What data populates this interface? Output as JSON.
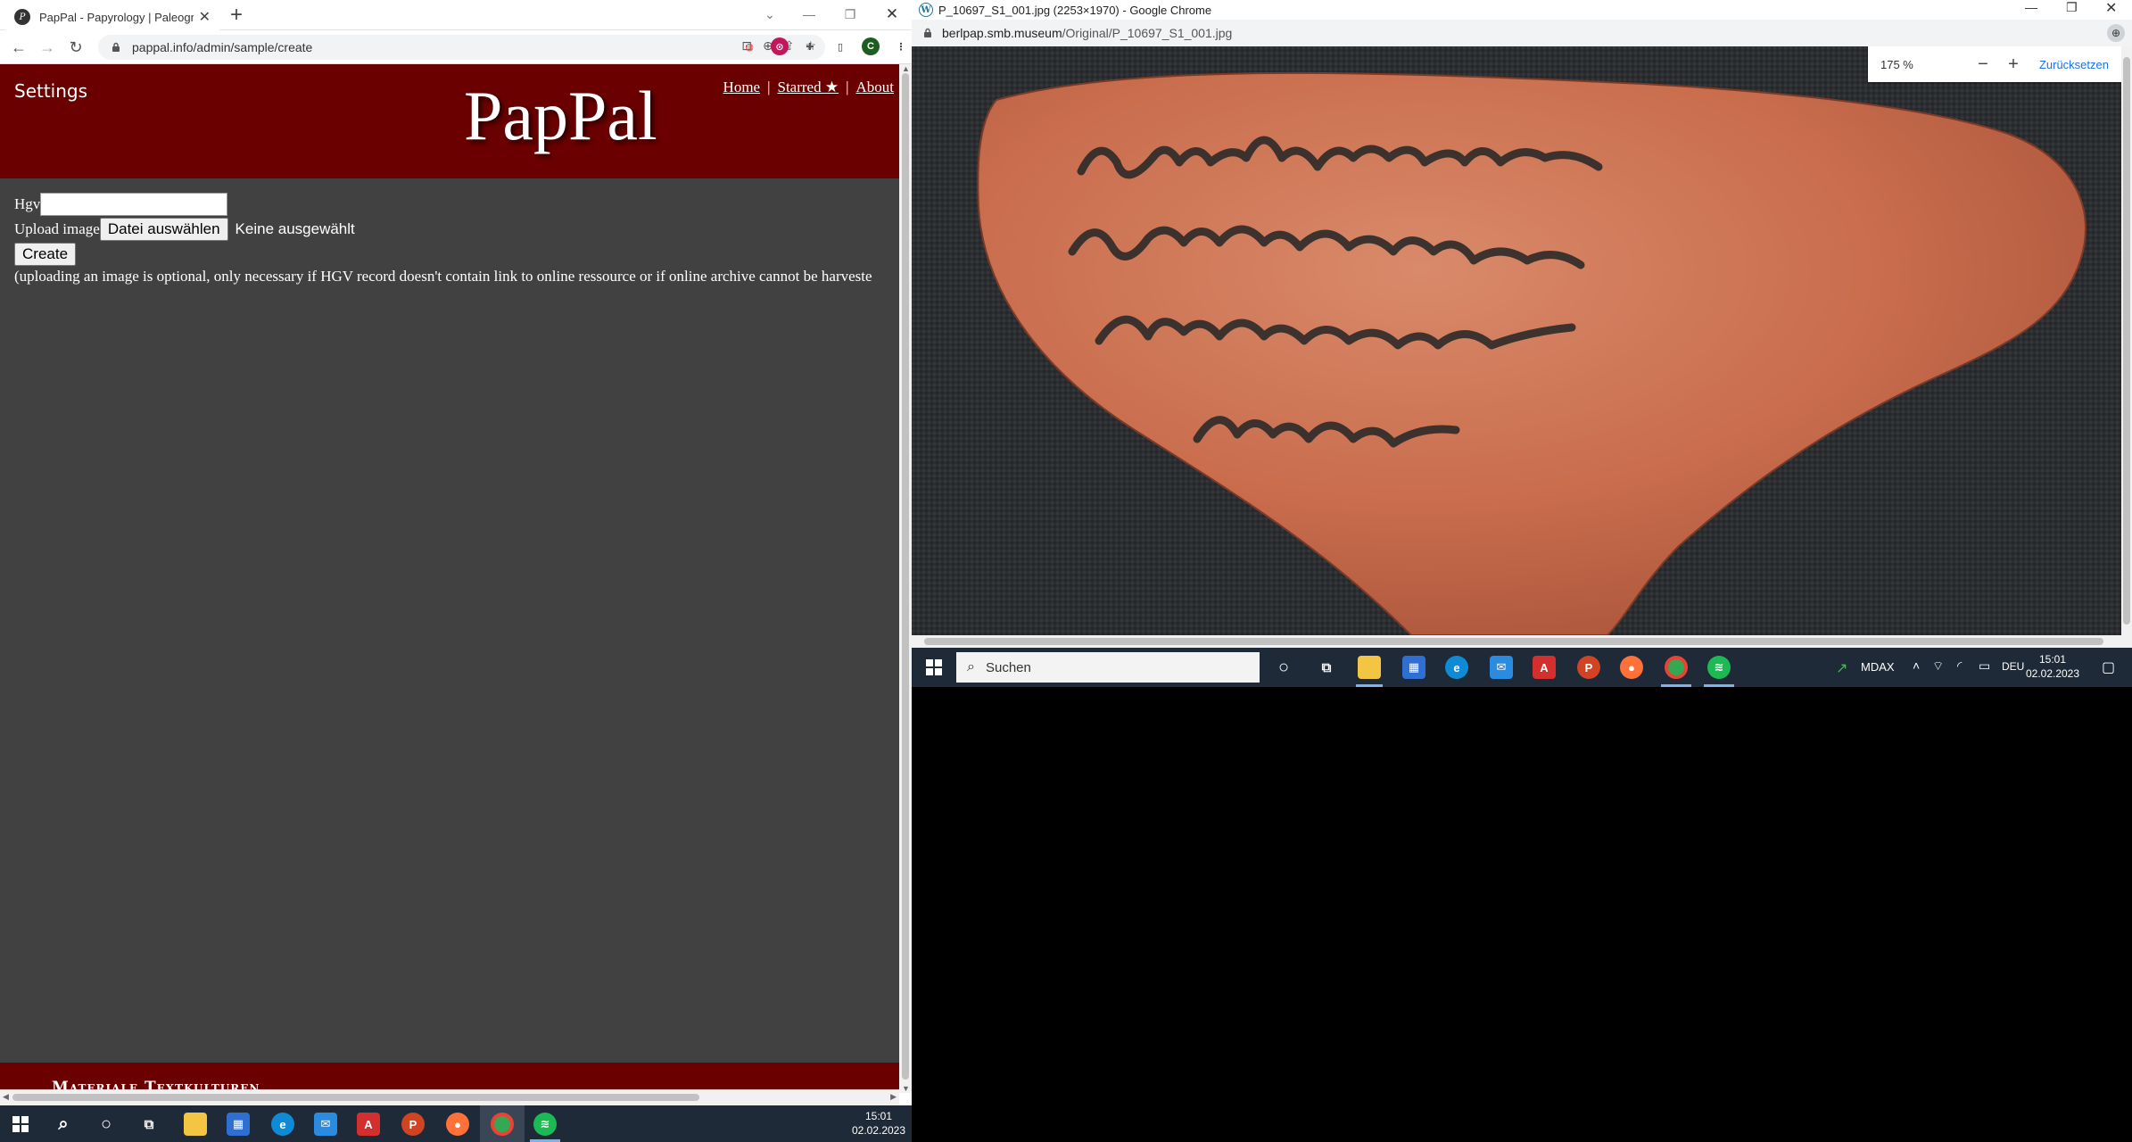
{
  "left_browser": {
    "tab_title": "PapPal - Papyrology | Paleograph",
    "url": "pappal.info/admin/sample/create",
    "profile_initial": "C"
  },
  "site": {
    "settings_label": "Settings",
    "logo": "PapPal",
    "nav": {
      "home": "Home",
      "starred": "Starred ★",
      "about": "About",
      "separator": "|"
    },
    "form": {
      "hgv_label": "Hgv",
      "hgv_value": "",
      "upload_label": "Upload image",
      "file_button": "Datei auswählen",
      "file_status": "Keine ausgewählt",
      "create_button": "Create",
      "note": "(uploading an image is optional, only necessary if HGV record doesn't contain link to online ressource or if online archive cannot be harveste"
    },
    "footer_text": "Materiale Textkulturen"
  },
  "right_browser": {
    "title": "P_10697_S1_001.jpg (2253×1970) - Google Chrome",
    "url_domain": "berlpap.smb.museum",
    "url_path": "/Original/P_10697_S1_001.jpg",
    "zoom_level": "175 %",
    "zoom_out": "−",
    "zoom_in": "+",
    "reset_label": "Zurücksetzen",
    "image_alt": "ostracon-image"
  },
  "taskbar_right": {
    "search_text": "Suchen",
    "tray_label": "MDAX",
    "lang": "DEU",
    "time": "15:01",
    "date": "02.02.2023"
  },
  "taskbar_left": {
    "time": "15:01",
    "date": "02.02.2023"
  },
  "colors": {
    "header_red": "#6b0000",
    "page_bg": "#414141",
    "taskbar": "#1f2a38"
  }
}
